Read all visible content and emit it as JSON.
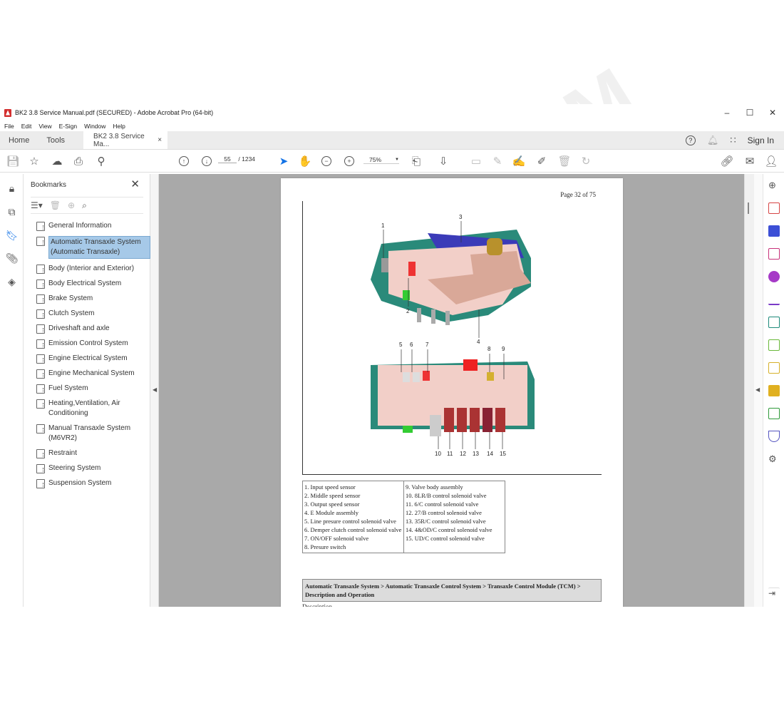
{
  "window": {
    "title": "BK2 3.8 Service Manual.pdf (SECURED) - Adobe Acrobat Pro (64-bit)",
    "controls": {
      "minimize": "–",
      "maximize": "☐",
      "close": "✕"
    }
  },
  "menu": [
    "File",
    "Edit",
    "View",
    "E-Sign",
    "Window",
    "Help"
  ],
  "tabs": {
    "home": "Home",
    "tools": "Tools",
    "document": "BK2 3.8 Service Ma...",
    "close": "×",
    "sign_in": "Sign In",
    "help": "?"
  },
  "toolbar": {
    "current_page": "55",
    "page_separator": "/",
    "total_pages": "1234",
    "zoom": "75%",
    "icons": [
      "save-icon",
      "bookmark-star-icon",
      "upload-cloud-icon",
      "print-icon",
      "search-zoom-icon",
      "prev-page-icon",
      "next-page-icon",
      "select-cursor-icon",
      "hand-tool-icon",
      "zoom-out-icon",
      "zoom-in-icon",
      "fit-page-icon",
      "scroll-mode-icon",
      "comment-icon",
      "highlight-icon",
      "sign-icon",
      "edit-pdf-icon",
      "delete-icon",
      "rotate-icon",
      "share-link-icon",
      "email-icon",
      "add-user-icon"
    ]
  },
  "bookmarks": {
    "title": "Bookmarks",
    "close": "✕",
    "items": [
      {
        "label": "General Information",
        "selected": false
      },
      {
        "label": "Automatic Transaxle System (Automatic Transaxle)",
        "selected": true
      },
      {
        "label": "Body (Interior and Exterior)",
        "selected": false
      },
      {
        "label": "Body Electrical System",
        "selected": false
      },
      {
        "label": "Brake System",
        "selected": false
      },
      {
        "label": "Clutch System",
        "selected": false
      },
      {
        "label": "Driveshaft and axle",
        "selected": false
      },
      {
        "label": "Emission Control System",
        "selected": false
      },
      {
        "label": "Engine Electrical System",
        "selected": false
      },
      {
        "label": "Engine Mechanical System",
        "selected": false
      },
      {
        "label": "Fuel System",
        "selected": false
      },
      {
        "label": "Heating,Ventilation, Air Conditioning",
        "selected": false
      },
      {
        "label": "Manual Transaxle System (M6VR2)",
        "selected": false
      },
      {
        "label": "Restraint",
        "selected": false
      },
      {
        "label": "Steering System",
        "selected": false
      },
      {
        "label": "Suspension System",
        "selected": false
      }
    ]
  },
  "document": {
    "page_label": "Page 32 of 75",
    "callouts_top": [
      "1",
      "2",
      "3",
      "4"
    ],
    "callouts_bottom": [
      "5",
      "6",
      "7",
      "8",
      "9",
      "10",
      "11",
      "12",
      "13",
      "14",
      "15"
    ],
    "legend_left": [
      "1. Input speed sensor",
      "2. Middle speed sensor",
      "3. Output speed sensor",
      "4. E Module assembly",
      "5. Line presure control solenoid valve",
      "6. Demper clutch control solenoid valve",
      "7. ON/OFF solenoid valve",
      "8. Presure switch"
    ],
    "legend_right": [
      "9. Valve body assembly",
      "10. 8LR/B control solenoid valve",
      "11. 6/C control solenoid valve",
      "12. 27/B control solenoid valve",
      "13. 35R/C control solenoid valve",
      "14. 4&OD/C control solenoid valve",
      "15. UD/C control solenoid valve"
    ],
    "section_heading": "Automatic Transaxle System > Automatic Transaxle Control System > Transaxle Control Module (TCM) > Description and Operation",
    "next_text": "Description"
  },
  "watermark": "EPCDEPO.COM",
  "colors": {
    "accent": "#1473e6",
    "selection": "#a6c9e8",
    "viewer_bg": "#a9a9a9"
  }
}
